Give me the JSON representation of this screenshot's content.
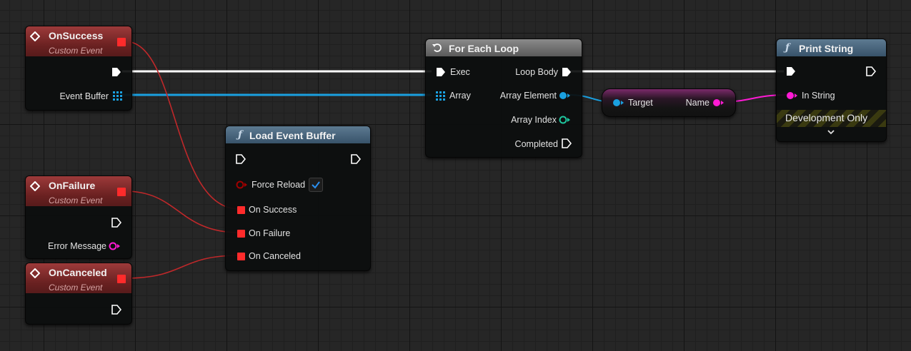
{
  "colors": {
    "exec": "#ffffff",
    "delegate": "#e03030",
    "struct_array": "#1aa0e0",
    "string": "#ff1ad4",
    "integer": "#1ec8a0",
    "bool": "#a00000",
    "event_header": "#8f3333",
    "function_header": "#4c6880"
  },
  "nodes": {
    "on_success": {
      "title": "OnSuccess",
      "subtitle": "Custom Event",
      "icon": "event-diamond-icon",
      "pins": {
        "event_buffer": "Event Buffer"
      }
    },
    "on_failure": {
      "title": "OnFailure",
      "subtitle": "Custom Event",
      "icon": "event-diamond-icon",
      "pins": {
        "error_message": "Error Message"
      }
    },
    "on_canceled": {
      "title": "OnCanceled",
      "subtitle": "Custom Event",
      "icon": "event-diamond-icon"
    },
    "load_event_buffer": {
      "title": "Load Event Buffer",
      "icon": "function-icon",
      "pins": {
        "force_reload": "Force Reload",
        "on_success": "On Success",
        "on_failure": "On Failure",
        "on_canceled": "On Canceled"
      },
      "force_reload_checked": true
    },
    "for_each_loop": {
      "title": "For Each Loop",
      "icon": "loop-icon",
      "pins": {
        "exec": "Exec",
        "array": "Array",
        "loop_body": "Loop Body",
        "array_element": "Array Element",
        "array_index": "Array Index",
        "completed": "Completed"
      }
    },
    "break_node": {
      "pins": {
        "target": "Target",
        "name": "Name"
      }
    },
    "print_string": {
      "title": "Print String",
      "icon": "function-icon",
      "pins": {
        "in_string": "In String"
      },
      "footer": "Development Only"
    }
  }
}
